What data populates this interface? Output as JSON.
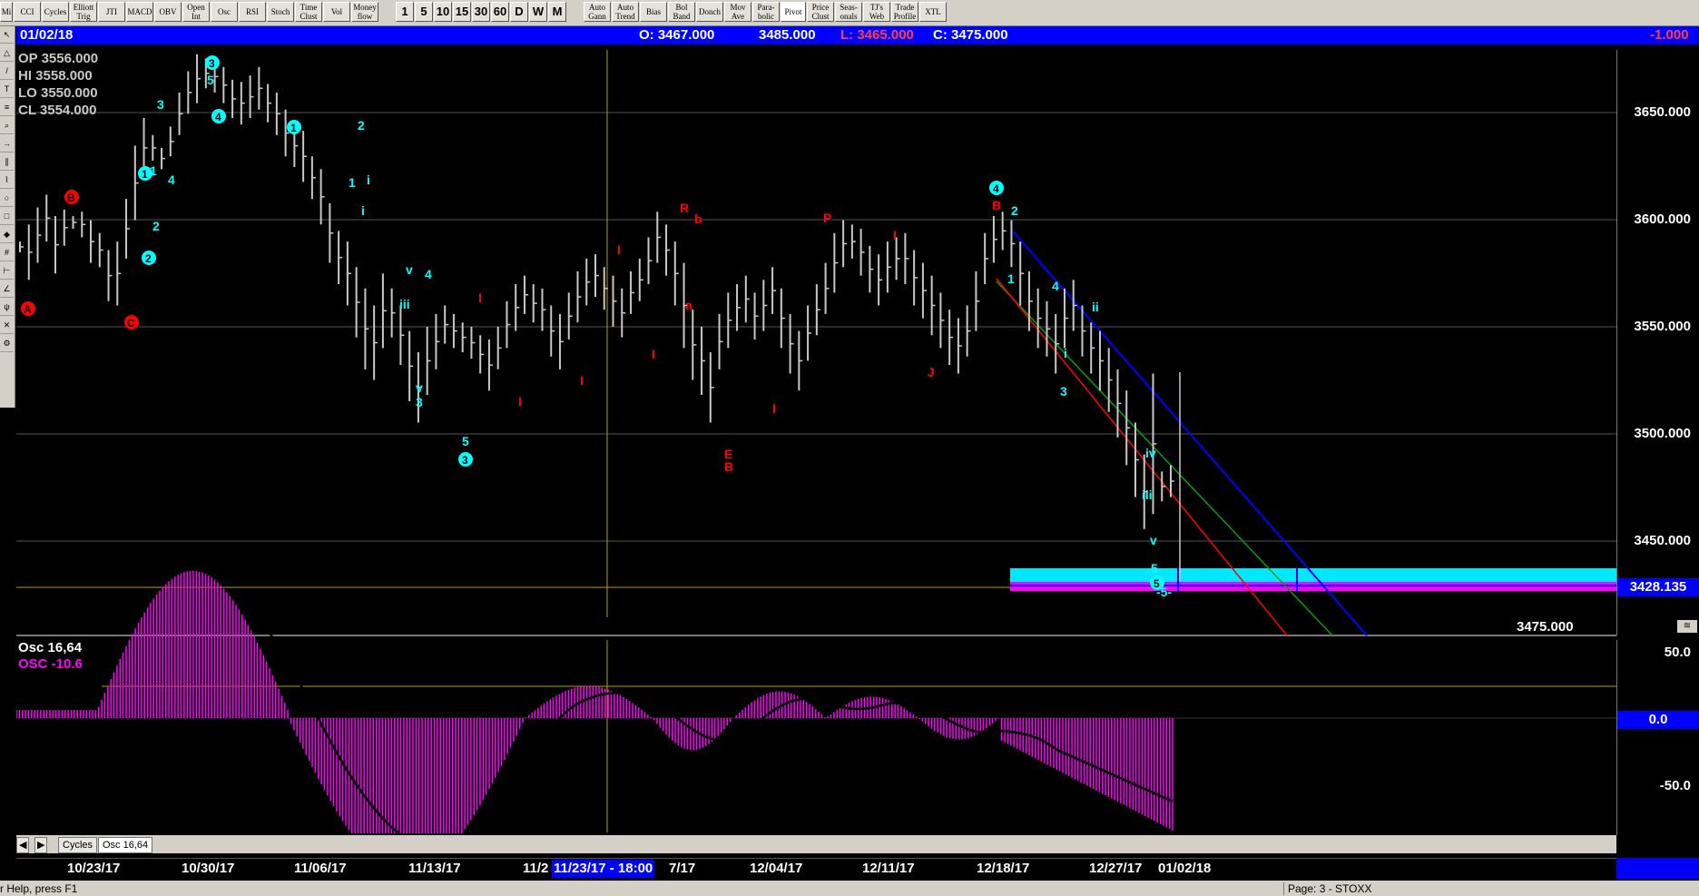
{
  "toolbar": {
    "buttons": [
      "Mi",
      "CCI",
      "Cycles",
      "Elliott\nTrig",
      "JTI",
      "MACD",
      "OBV",
      "Open\nInt",
      "Osc",
      "RSI",
      "Stoch",
      "Time\nClust",
      "Vol",
      "Money\nflow"
    ],
    "periods": [
      "1",
      "5",
      "10",
      "15",
      "30",
      "60",
      "D",
      "W",
      "M"
    ],
    "tools": [
      "Auto\nGann",
      "Auto\nTrend",
      "Bias",
      "Bol\nBand",
      "Donch",
      "Mov\nAve",
      "Para-\nbolic",
      "Pivot",
      "Price\nClust",
      "Seas-\nonals",
      "TJ's\nWeb",
      "Trade\nProfile",
      "XTL"
    ]
  },
  "infobar": {
    "date": "01/02/18",
    "open": "O: 3467.000",
    "high": "3485.000",
    "low": "L: 3465.000",
    "close": "C: 3475.000",
    "change": "-1.000"
  },
  "ohlc": {
    "op": "OP  3556.000",
    "hi": "HI   3558.000",
    "lo": "LO  3550.000",
    "cl": "CL  3554.000"
  },
  "price_axis": {
    "labels": [
      "3650.000",
      "3600.000",
      "3550.000",
      "3500.000",
      "3450.000"
    ],
    "current": "3428.135",
    "cursor_value": "3475.000"
  },
  "oscillator": {
    "name": "Osc 16,64",
    "value_label": "OSC -10.6",
    "axis_labels": [
      "50.0",
      "0.0",
      "-50.0"
    ]
  },
  "tabs": [
    "Cycles",
    "Osc 16,64"
  ],
  "date_axis": {
    "labels": [
      "10/23/17",
      "10/30/17",
      "11/06/17",
      "11/13/17",
      "11/2",
      "7/17",
      "12/04/17",
      "12/11/17",
      "12/18/17",
      "12/27/17",
      "01/02/18"
    ],
    "cursor": "11/23/17 - 18:00"
  },
  "status": {
    "left": "r Help, press F1",
    "right": "Page: 3 - STOXX"
  },
  "colors": {
    "infobar": "#0000ff",
    "bars": "#c8c8c8",
    "osc": "#ff00ff",
    "wave_cyan": "#00ffff",
    "wave_red": "#ff0000"
  },
  "chart_data": {
    "type": "bar",
    "symbol": "STOXX",
    "ylim": [
      3405,
      3680
    ],
    "candles": [
      [
        3585,
        3590
      ],
      [
        3572,
        3598
      ],
      [
        3580,
        3606
      ],
      [
        3590,
        3612
      ],
      [
        3575,
        3602
      ],
      [
        3588,
        3605
      ],
      [
        3596,
        3602
      ],
      [
        3592,
        3604
      ],
      [
        3580,
        3600
      ],
      [
        3578,
        3594
      ],
      [
        3562,
        3586
      ],
      [
        3560,
        3590
      ],
      [
        3582,
        3610
      ],
      [
        3600,
        3635
      ],
      [
        3620,
        3648
      ],
      [
        3628,
        3640
      ],
      [
        3624,
        3634
      ],
      [
        3630,
        3644
      ],
      [
        3640,
        3660
      ],
      [
        3650,
        3670
      ],
      [
        3655,
        3678
      ],
      [
        3662,
        3676
      ],
      [
        3660,
        3675
      ],
      [
        3655,
        3672
      ],
      [
        3648,
        3666
      ],
      [
        3645,
        3665
      ],
      [
        3648,
        3668
      ],
      [
        3652,
        3672
      ],
      [
        3646,
        3664
      ],
      [
        3640,
        3660
      ],
      [
        3630,
        3652
      ],
      [
        3625,
        3645
      ],
      [
        3618,
        3642
      ],
      [
        3610,
        3630
      ],
      [
        3598,
        3624
      ],
      [
        3580,
        3608
      ],
      [
        3570,
        3595
      ],
      [
        3560,
        3590
      ],
      [
        3545,
        3578
      ],
      [
        3530,
        3568
      ],
      [
        3525,
        3560
      ],
      [
        3540,
        3575
      ],
      [
        3545,
        3568
      ],
      [
        3532,
        3560
      ],
      [
        3515,
        3548
      ],
      [
        3505,
        3538
      ],
      [
        3518,
        3550
      ],
      [
        3530,
        3556
      ],
      [
        3542,
        3560
      ],
      [
        3540,
        3556
      ],
      [
        3538,
        3552
      ],
      [
        3535,
        3550
      ],
      [
        3528,
        3546
      ],
      [
        3520,
        3544
      ],
      [
        3530,
        3550
      ],
      [
        3540,
        3562
      ],
      [
        3548,
        3570
      ],
      [
        3556,
        3574
      ],
      [
        3552,
        3570
      ],
      [
        3548,
        3568
      ],
      [
        3536,
        3560
      ],
      [
        3530,
        3556
      ],
      [
        3544,
        3566
      ],
      [
        3552,
        3576
      ],
      [
        3560,
        3582
      ],
      [
        3564,
        3584
      ],
      [
        3558,
        3578
      ],
      [
        3550,
        3574
      ],
      [
        3545,
        3568
      ],
      [
        3556,
        3576
      ],
      [
        3562,
        3582
      ],
      [
        3570,
        3592
      ],
      [
        3580,
        3604
      ],
      [
        3574,
        3598
      ],
      [
        3560,
        3590
      ],
      [
        3540,
        3580
      ],
      [
        3525,
        3558
      ],
      [
        3518,
        3550
      ],
      [
        3505,
        3538
      ],
      [
        3530,
        3556
      ],
      [
        3540,
        3566
      ],
      [
        3548,
        3570
      ],
      [
        3552,
        3574
      ],
      [
        3544,
        3566
      ],
      [
        3548,
        3572
      ],
      [
        3556,
        3578
      ],
      [
        3540,
        3568
      ],
      [
        3528,
        3556
      ],
      [
        3520,
        3548
      ],
      [
        3534,
        3560
      ],
      [
        3546,
        3570
      ],
      [
        3556,
        3580
      ],
      [
        3566,
        3594
      ],
      [
        3578,
        3600
      ],
      [
        3582,
        3598
      ],
      [
        3574,
        3596
      ],
      [
        3566,
        3588
      ],
      [
        3560,
        3584
      ],
      [
        3566,
        3590
      ],
      [
        3572,
        3592
      ],
      [
        3570,
        3594
      ],
      [
        3560,
        3586
      ],
      [
        3554,
        3580
      ],
      [
        3546,
        3574
      ],
      [
        3540,
        3566
      ],
      [
        3532,
        3558
      ],
      [
        3528,
        3554
      ],
      [
        3536,
        3560
      ],
      [
        3548,
        3576
      ],
      [
        3570,
        3594
      ],
      [
        3580,
        3602
      ],
      [
        3586,
        3604
      ],
      [
        3578,
        3600
      ],
      [
        3560,
        3590
      ],
      [
        3548,
        3576
      ],
      [
        3540,
        3568
      ],
      [
        3536,
        3562
      ],
      [
        3528,
        3556
      ],
      [
        3540,
        3568
      ],
      [
        3548,
        3572
      ],
      [
        3536,
        3560
      ],
      [
        3528,
        3552
      ],
      [
        3520,
        3548
      ],
      [
        3510,
        3540
      ],
      [
        3498,
        3530
      ],
      [
        3485,
        3520
      ],
      [
        3470,
        3505
      ],
      [
        3455,
        3490
      ],
      [
        3462,
        3528
      ],
      [
        3468,
        3482
      ],
      [
        3470,
        3485
      ]
    ]
  }
}
